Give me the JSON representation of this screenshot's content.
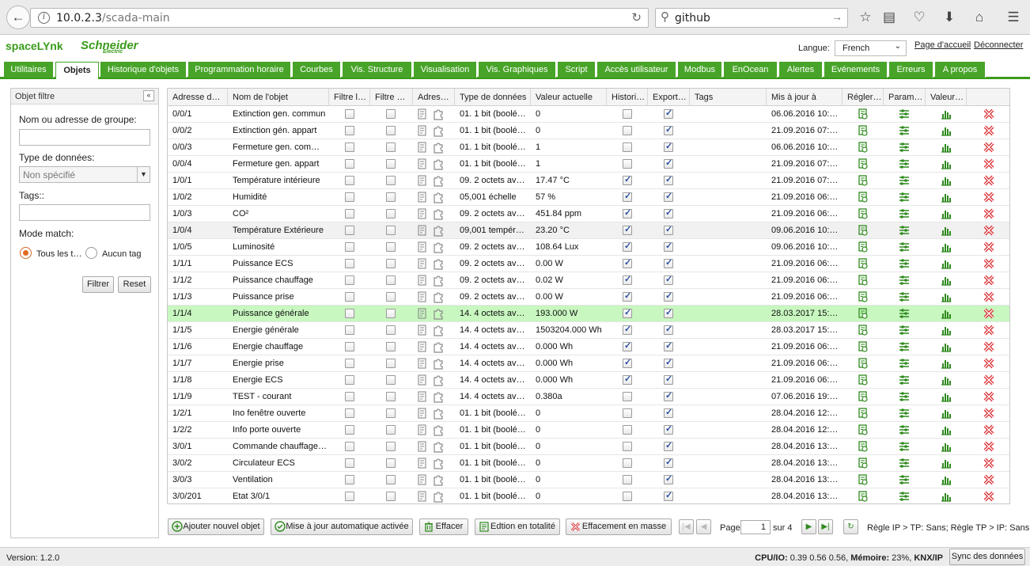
{
  "browser": {
    "url_host": "10.0.2.3",
    "url_path": "/scada-main",
    "search_text": "github"
  },
  "app": {
    "brand": "spaceLYnk",
    "logo_text": "Schneider",
    "logo_sub": "Electric",
    "language_label": "Langue:",
    "language_value": "French",
    "home_link": "Page d'accueil",
    "logout_link": "Déconnecter"
  },
  "tabs": [
    "Utilitaires",
    "Objets",
    "Historique d'objets",
    "Programmation horaire",
    "Courbes",
    "Vis. Structure",
    "Visualisation",
    "Vis. Graphiques",
    "Script",
    "Accès utilisateur",
    "Modbus",
    "EnOcean",
    "Alertes",
    "Evénements",
    "Erreurs",
    "A propos"
  ],
  "active_tab": "Objets",
  "filter_panel": {
    "title": "Objet filtre",
    "name_label": "Nom ou adresse de groupe:",
    "name_value": "",
    "type_label": "Type de données:",
    "type_value": "Non spécifié",
    "tags_label": "Tags::",
    "tags_value": "",
    "mode_label": "Mode match:",
    "mode_all": "Tous les t…",
    "mode_none": "Aucun tag",
    "filter_button": "Filtrer",
    "reset_button": "Reset"
  },
  "columns": [
    "Adresse d…",
    "Nom de l'objet",
    "Filtre l…",
    "Filtre …",
    "Adres…",
    "Type de données",
    "Valeur actuelle",
    "Histori…",
    "Export…",
    "Tags",
    "Mis à jour à",
    "Régler…",
    "Param…",
    "Valeur…",
    ""
  ],
  "rows": [
    {
      "addr": "0/0/1",
      "name": "Extinction gen. commun",
      "type": "01. 1 bit (boolé…",
      "value": "0",
      "hist": false,
      "export": true,
      "updated": "06.06.2016 10:…"
    },
    {
      "addr": "0/0/2",
      "name": "Extinction gén. appart",
      "type": "01. 1 bit (boolé…",
      "value": "0",
      "hist": false,
      "export": true,
      "updated": "21.09.2016 07:…"
    },
    {
      "addr": "0/0/3",
      "name": "Fermeture gen. com…",
      "type": "01. 1 bit (boolé…",
      "value": "1",
      "hist": false,
      "export": true,
      "updated": "06.06.2016 10:…"
    },
    {
      "addr": "0/0/4",
      "name": "Fermeture gen. appart",
      "type": "01. 1 bit (boolé…",
      "value": "1",
      "hist": false,
      "export": true,
      "updated": "21.09.2016 07:…"
    },
    {
      "addr": "1/0/1",
      "name": "Température intérieure",
      "type": "09. 2 octets av…",
      "value": "17.47 °C",
      "hist": true,
      "export": true,
      "updated": "21.09.2016 07:…"
    },
    {
      "addr": "1/0/2",
      "name": "Humidité",
      "type": "05,001 échelle",
      "value": "57 %",
      "hist": true,
      "export": true,
      "updated": "21.09.2016 06:…"
    },
    {
      "addr": "1/0/3",
      "name": "CO²",
      "type": "09. 2 octets av…",
      "value": "451.84 ppm",
      "hist": true,
      "export": true,
      "updated": "21.09.2016 06:…"
    },
    {
      "addr": "1/0/4",
      "name": "Température Extérieure",
      "type": "09,001 tempér…",
      "value": "23.20 °C",
      "hist": true,
      "export": true,
      "updated": "09.06.2016 10:…"
    },
    {
      "addr": "1/0/5",
      "name": "Luminosité",
      "type": "09. 2 octets av…",
      "value": "108.64 Lux",
      "hist": true,
      "export": true,
      "updated": "09.06.2016 10:…"
    },
    {
      "addr": "1/1/1",
      "name": "Puissance ECS",
      "type": "09. 2 octets av…",
      "value": "0.00 W",
      "hist": true,
      "export": true,
      "updated": "21.09.2016 06:…"
    },
    {
      "addr": "1/1/2",
      "name": "Puissance chauffage",
      "type": "09. 2 octets av…",
      "value": "0.02 W",
      "hist": true,
      "export": true,
      "updated": "21.09.2016 06:…"
    },
    {
      "addr": "1/1/3",
      "name": "Puissance prise",
      "type": "09. 2 octets av…",
      "value": "0.00 W",
      "hist": true,
      "export": true,
      "updated": "21.09.2016 06:…"
    },
    {
      "addr": "1/1/4",
      "name": "Puissance générale",
      "type": "14. 4 octets av…",
      "value": "193.000 W",
      "hist": true,
      "export": true,
      "updated": "28.03.2017 15:…"
    },
    {
      "addr": "1/1/5",
      "name": "Energie générale",
      "type": "14. 4 octets av…",
      "value": "1503204.000 Wh",
      "hist": true,
      "export": true,
      "updated": "28.03.2017 15:…"
    },
    {
      "addr": "1/1/6",
      "name": "Energie chauffage",
      "type": "14. 4 octets av…",
      "value": "0.000 Wh",
      "hist": true,
      "export": true,
      "updated": "21.09.2016 06:…"
    },
    {
      "addr": "1/1/7",
      "name": "Energie prise",
      "type": "14. 4 octets av…",
      "value": "0.000 Wh",
      "hist": true,
      "export": true,
      "updated": "21.09.2016 06:…"
    },
    {
      "addr": "1/1/8",
      "name": "Energie ECS",
      "type": "14. 4 octets av…",
      "value": "0.000 Wh",
      "hist": true,
      "export": true,
      "updated": "21.09.2016 06:…"
    },
    {
      "addr": "1/1/9",
      "name": "TEST - courant",
      "type": "14. 4 octets av…",
      "value": "0.380a",
      "hist": false,
      "export": true,
      "updated": "07.06.2016 19:…"
    },
    {
      "addr": "1/2/1",
      "name": "Ino fenêtre ouverte",
      "type": "01. 1 bit (boolé…",
      "value": "0",
      "hist": false,
      "export": true,
      "updated": "28.04.2016 12:…"
    },
    {
      "addr": "1/2/2",
      "name": "Info porte ouverte",
      "type": "01. 1 bit (boolé…",
      "value": "0",
      "hist": false,
      "export": true,
      "updated": "28.04.2016 12:…"
    },
    {
      "addr": "3/0/1",
      "name": "Commande chauffage…",
      "type": "01. 1 bit (boolé…",
      "value": "0",
      "hist": false,
      "export": true,
      "updated": "28.04.2016 13:…"
    },
    {
      "addr": "3/0/2",
      "name": "Circulateur ECS",
      "type": "01. 1 bit (boolé…",
      "value": "0",
      "hist": false,
      "export": true,
      "updated": "28.04.2016 13:…"
    },
    {
      "addr": "3/0/3",
      "name": "Ventilation",
      "type": "01. 1 bit (boolé…",
      "value": "0",
      "hist": false,
      "export": true,
      "updated": "28.04.2016 13:…"
    },
    {
      "addr": "3/0/201",
      "name": "Etat 3/0/1",
      "type": "01. 1 bit (boolé…",
      "value": "0",
      "hist": false,
      "export": true,
      "updated": "28.04.2016 13:…"
    }
  ],
  "selected_row": "1/1/4",
  "highlight_row": "1/0/4",
  "toolbar": {
    "add": "Ajouter nouvel objet",
    "auto_update": "Mise à jour automatique activée",
    "delete": "Effacer",
    "edit_all": "Edtion en totalité",
    "mass_delete": "Effacement en masse",
    "page_label": "Page",
    "page_value": "1",
    "page_total": "sur 4",
    "rule_text": "Règle IP > TP: Sans; Règle TP > IP: Sans"
  },
  "status": {
    "version": "Version: 1.2.0",
    "cpu_label": "CPU/IO:",
    "cpu_value": " 0.39 0.56 0.56, ",
    "mem_label": "Mémoire:",
    "mem_value": " 23%, ",
    "knx_label": "KNX/IP",
    "sync_button": "Sync des données"
  },
  "colors": {
    "accent_green": "#48a429",
    "selected_row": "#c8f7c0",
    "delete_red": "#d9262b"
  }
}
